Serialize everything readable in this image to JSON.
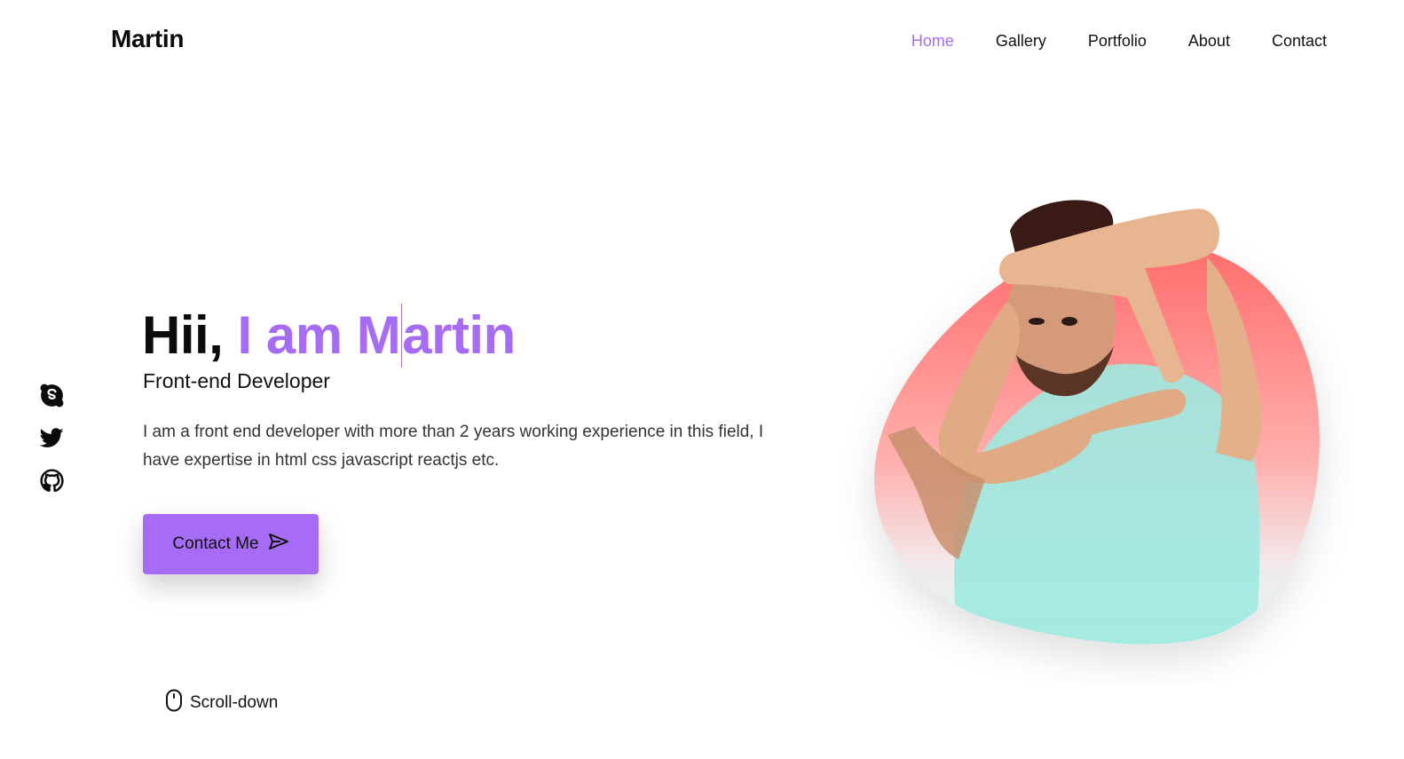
{
  "brand": "Martin",
  "nav": [
    {
      "label": "Home",
      "active": true
    },
    {
      "label": "Gallery",
      "active": false
    },
    {
      "label": "Portfolio",
      "active": false
    },
    {
      "label": "About",
      "active": false
    },
    {
      "label": "Contact",
      "active": false
    }
  ],
  "social": [
    {
      "icon": "skype-icon"
    },
    {
      "icon": "twitter-icon"
    },
    {
      "icon": "github-icon"
    }
  ],
  "hero": {
    "title_intro": "Hii, ",
    "title_accent_before_caret": "I am M",
    "title_accent_after_caret": "artin",
    "subtitle": "Front-end Developer",
    "description": "I am a front end developer with more than 2 years working experience in this field, I have expertise in html css javascript reactjs etc.",
    "cta_label": "Contact Me",
    "cta_icon": "send-icon"
  },
  "scroll": {
    "label": "Scroll-down",
    "icon": "mouse-icon"
  },
  "colors": {
    "accent": "#a66cf5",
    "blob_top": "#ff6b6b",
    "blob_bottom": "#d9fbf3"
  }
}
